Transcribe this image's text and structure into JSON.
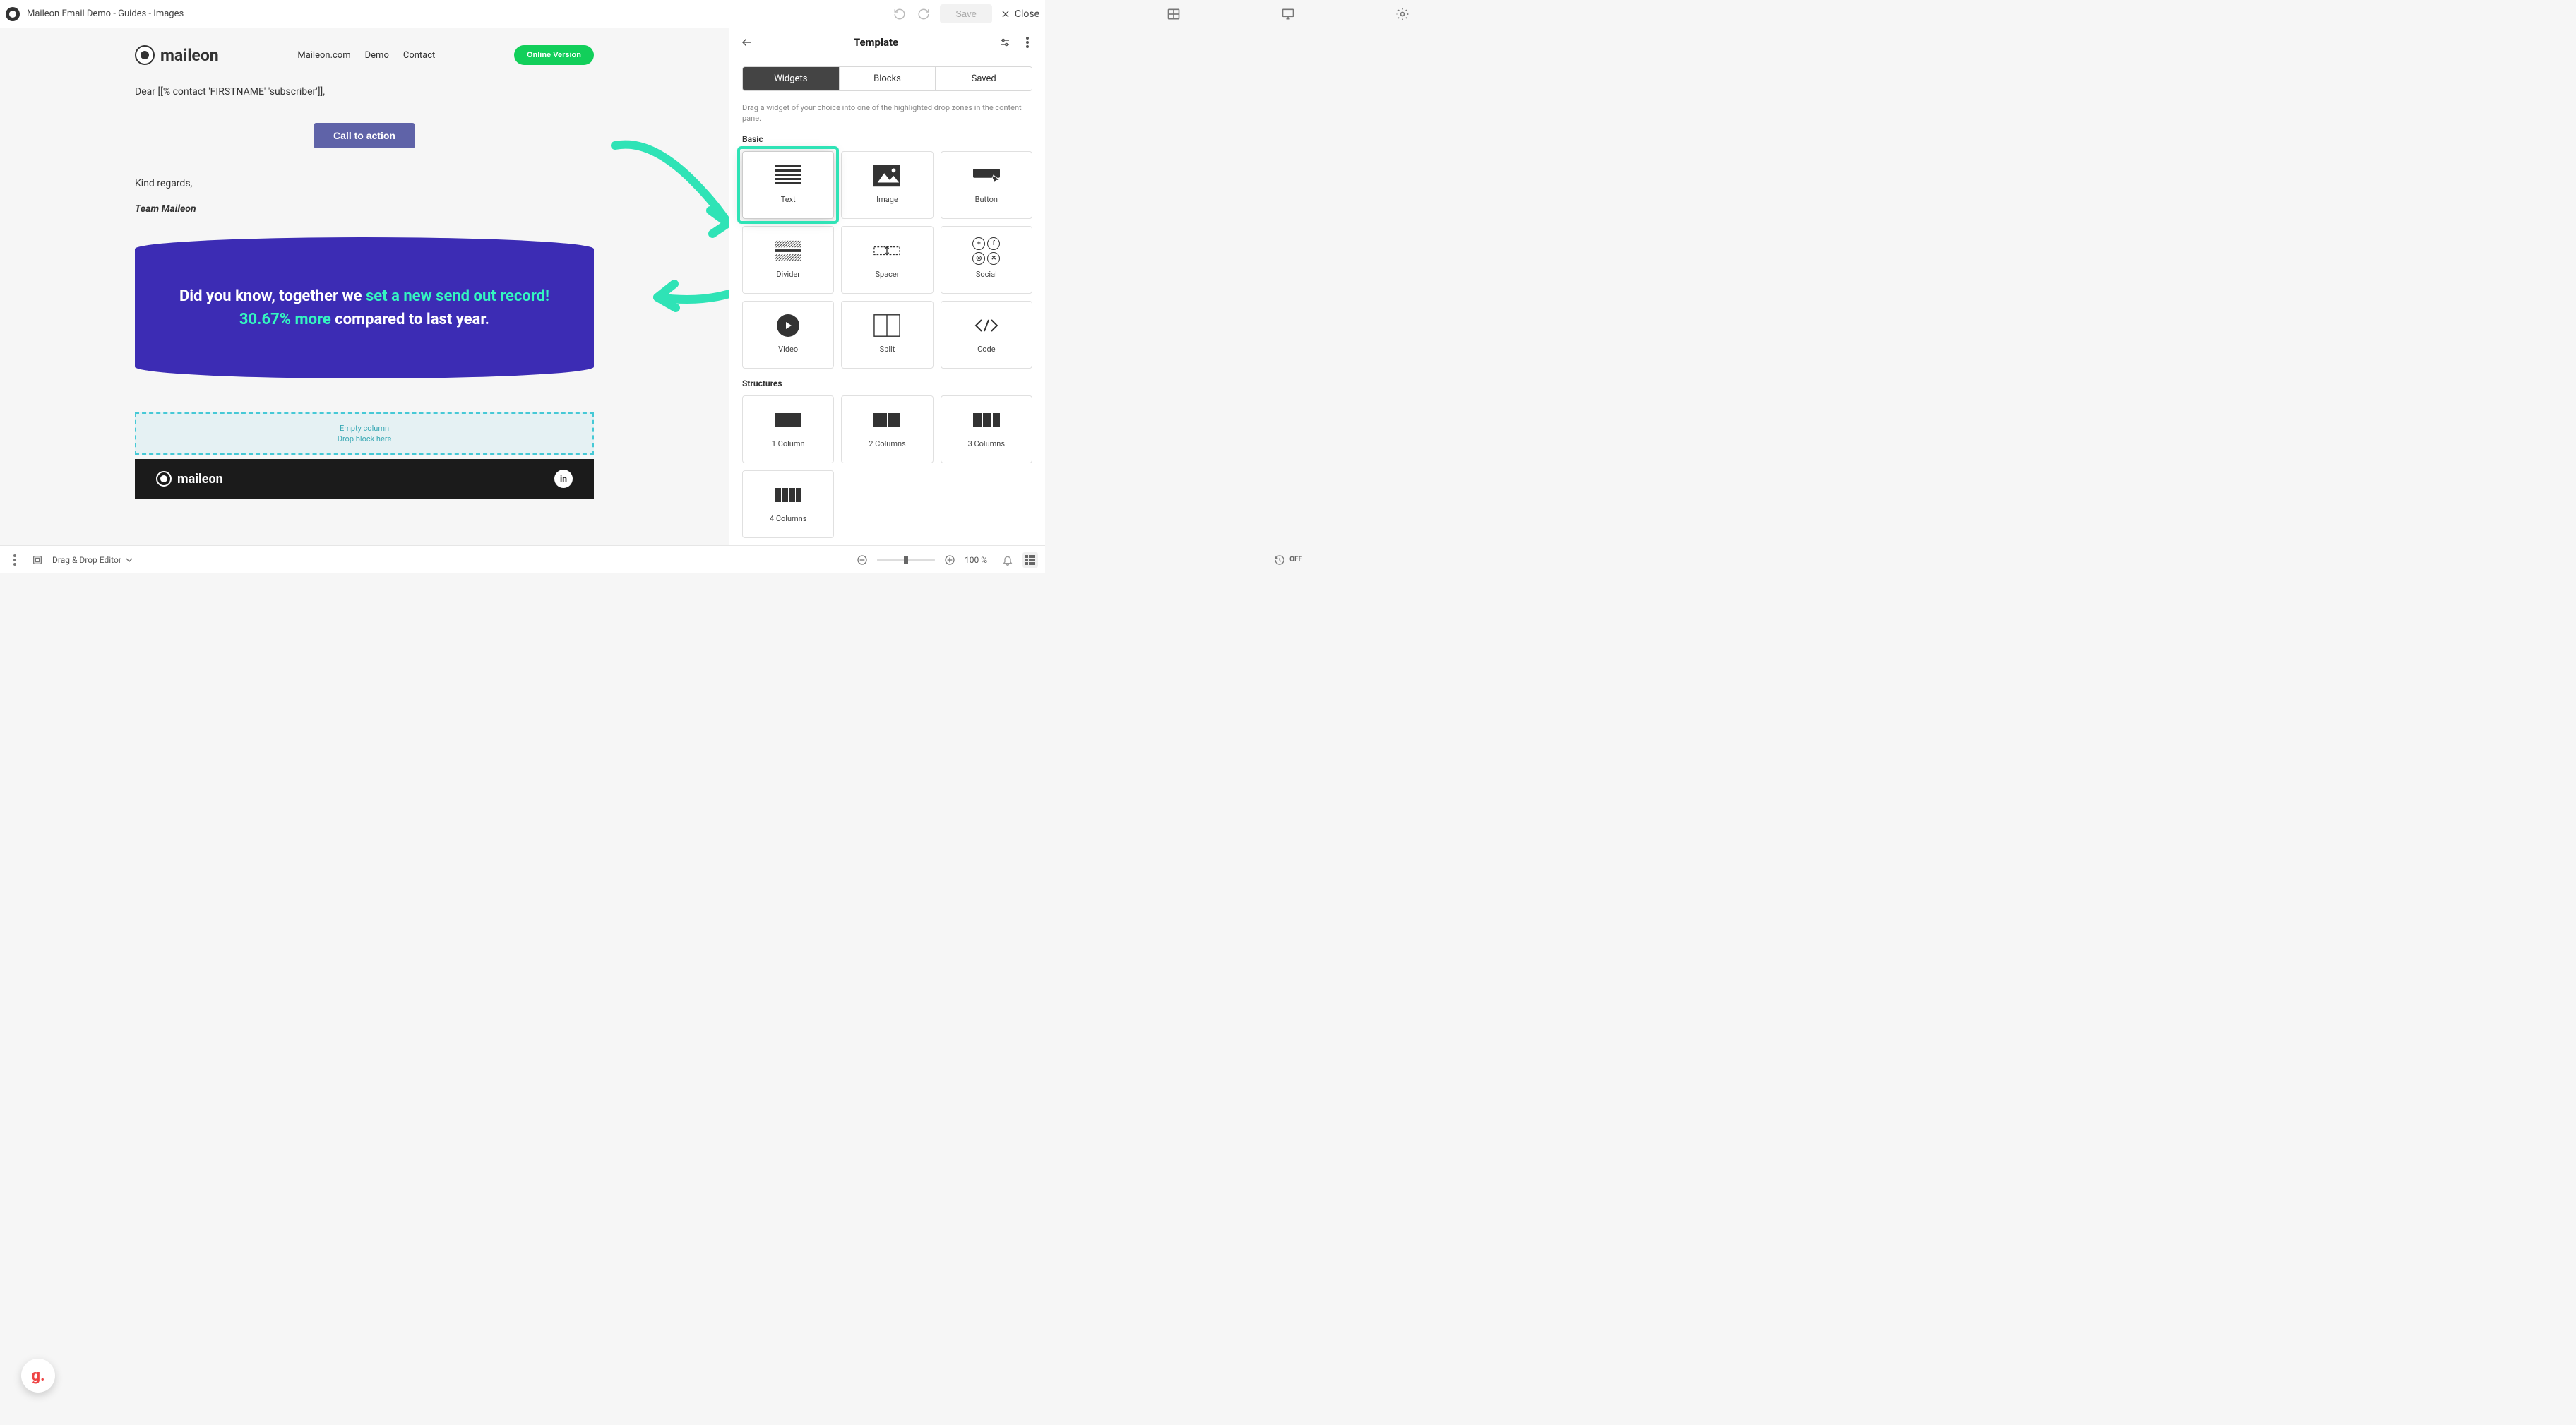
{
  "topbar": {
    "doc_title": "Maileon Email Demo - Guides - Images",
    "save_label": "Save",
    "close_label": "Close"
  },
  "email": {
    "brand": "maileon",
    "nav_1": "Maileon.com",
    "nav_2": "Demo",
    "nav_3": "Contact",
    "online_version": "Online Version",
    "greeting": "Dear [[% contact 'FIRSTNAME' 'subscriber']],",
    "cta": "Call to action",
    "regards": "Kind regards,",
    "team": "Team Maileon",
    "hero_plain1": "Did you know, together we ",
    "hero_accent1": "set a new send out record! 30.67% more",
    "hero_plain2": " compared to last year.",
    "dropzone_title": "Empty column",
    "dropzone_sub": "Drop block here",
    "footer_brand": "maileon",
    "footer_social": "in"
  },
  "panel": {
    "title": "Template",
    "tabs": {
      "widgets": "Widgets",
      "blocks": "Blocks",
      "saved": "Saved"
    },
    "helper": "Drag a widget of your choice into one of the highlighted drop zones in the content pane.",
    "section_basic": "Basic",
    "section_structures": "Structures",
    "widgets": {
      "text": "Text",
      "image": "Image",
      "button": "Button",
      "divider": "Divider",
      "spacer": "Spacer",
      "social": "Social",
      "video": "Video",
      "split": "Split",
      "code": "Code"
    },
    "structures": {
      "col1": "1 Column",
      "col2": "2 Columns",
      "col3": "3 Columns",
      "col4": "4 Columns"
    }
  },
  "bottombar": {
    "mode_label": "Drag & Drop Editor",
    "off_label": "OFF",
    "zoom_label": "100 %"
  }
}
